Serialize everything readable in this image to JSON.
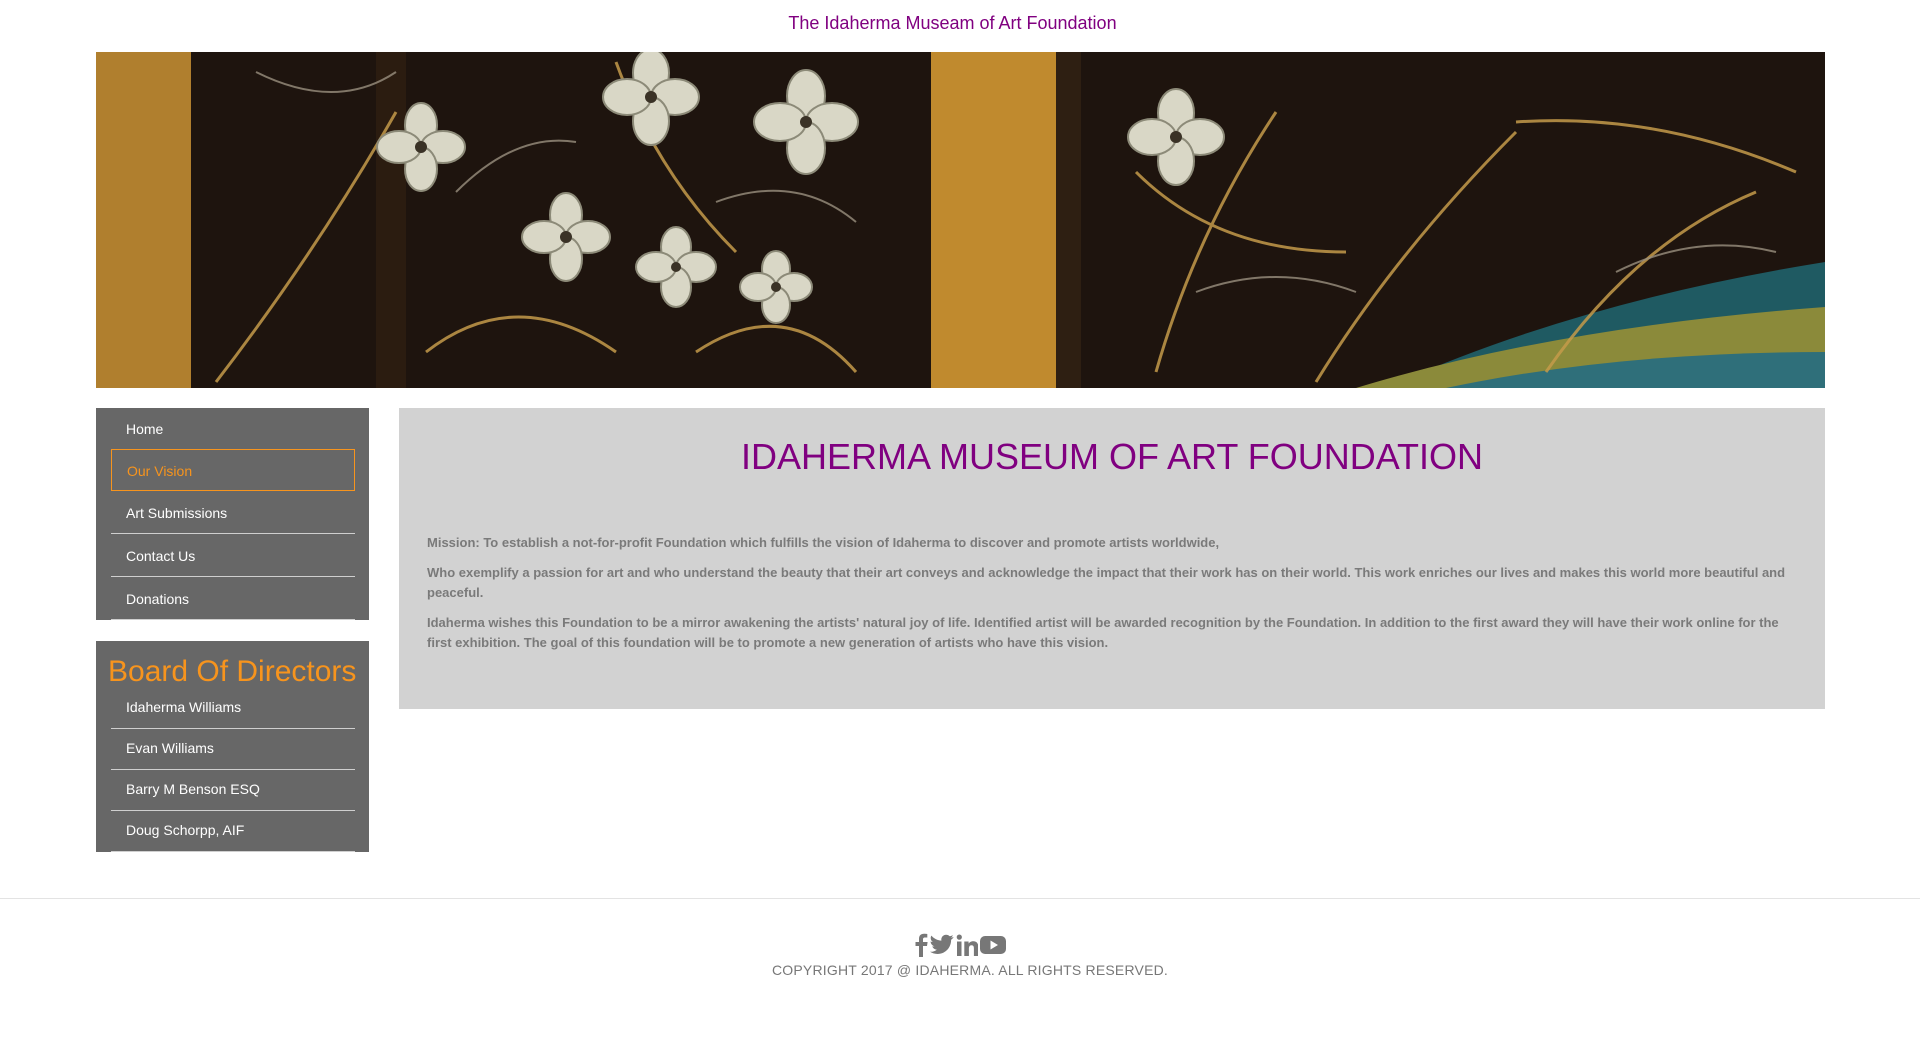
{
  "header": {
    "site_title": "The Idaherma Museam of Art Foundation"
  },
  "banner": {
    "alt": "Painted floral banner"
  },
  "nav": {
    "items": [
      {
        "label": "Home",
        "active": false
      },
      {
        "label": "Our Vision",
        "active": true
      },
      {
        "label": "Art Submissions",
        "active": false
      },
      {
        "label": "Contact Us",
        "active": false
      },
      {
        "label": "Donations",
        "active": false
      }
    ]
  },
  "board": {
    "title": "Board Of Directors",
    "members": [
      "Idaherma Williams",
      "Evan Williams",
      "Barry M Benson ESQ",
      "Doug Schorpp, AIF"
    ]
  },
  "main": {
    "heading": "IDAHERMA MUSEUM OF ART FOUNDATION",
    "paragraphs": [
      "Mission: To establish a not-for-profit Foundation which fulfills the vision of Idaherma to discover and promote artists worldwide,",
      "Who exemplify a passion for art and who understand the beauty that their art conveys and acknowledge the impact that their work has on their world. This work enriches our lives and makes this world more beautiful and peaceful.",
      "Idaherma wishes this Foundation to be a mirror awakening the artists' natural joy of life. Identified artist will be awarded recognition by the Foundation. In addition to the first award they will have their work online for the first exhibition. The goal of this foundation will be to promote a new generation of artists who have this vision."
    ]
  },
  "footer": {
    "social": [
      "facebook-icon",
      "twitter-icon",
      "linkedin-icon",
      "youtube-icon"
    ],
    "copyright": "COPYRIGHT 2017 @ IDAHERMA. ALL RIGHTS RESERVED."
  },
  "colors": {
    "accent_purple": "#800080",
    "accent_orange": "#f7941d",
    "sidebar_bg": "#676767",
    "content_bg": "#d2d2d2"
  }
}
